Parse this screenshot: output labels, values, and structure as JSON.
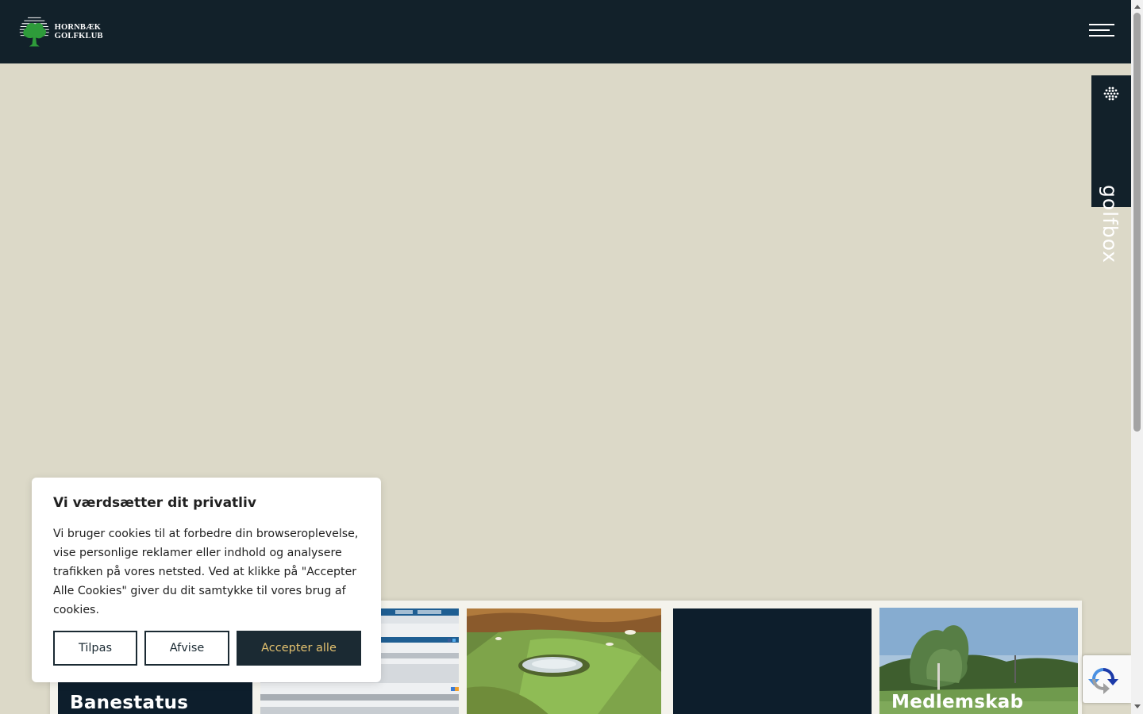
{
  "header": {
    "logo_text": "HORNBÆK GOLFKLUB",
    "menu_icon": "hamburger-icon"
  },
  "side_tab": {
    "label": "golfbox",
    "icon": "golfbox-globe-icon"
  },
  "cards": [
    {
      "title": "Banestatus",
      "image": "dark-panel"
    },
    {
      "title": "",
      "image": "website-screenshot"
    },
    {
      "title": "",
      "image": "golf-course-aerial"
    },
    {
      "title": "",
      "image": "dark-panel"
    },
    {
      "title": "Medlemskab",
      "image": "clubhouse-photo"
    }
  ],
  "cookie_banner": {
    "title": "Vi værdsætter dit privatliv",
    "body": "Vi bruger cookies til at forbedre din browseroplevelse, vise personlige reklamer eller indhold og analysere trafikken på vores netsted. Ved at klikke på \"Accepter Alle Cookies\" giver du dit samtykke til vores brug af cookies.",
    "buttons": {
      "customize": "Tilpas",
      "reject": "Afvise",
      "accept": "Accepter alle"
    }
  },
  "recaptcha": {
    "icon": "recaptcha-icon"
  },
  "colors": {
    "header_bg": "#12212a",
    "page_bg": "#dcd9c8",
    "accent_gold": "#e3c16f",
    "dark_navy": "#0d1e2c"
  }
}
